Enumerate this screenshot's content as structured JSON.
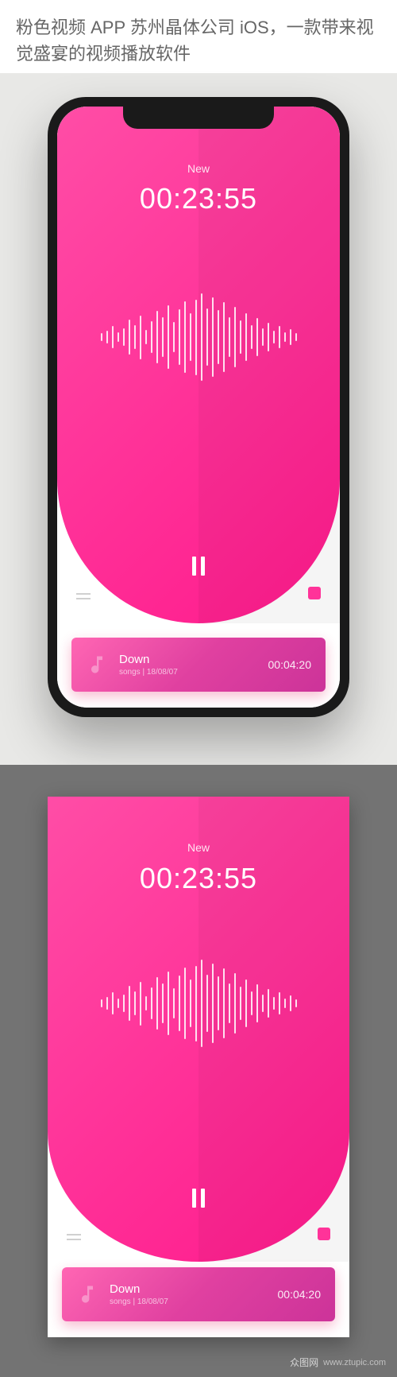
{
  "header": {
    "title": "粉色视频 APP 苏州晶体公司 iOS，一款带来视觉盛宴的视频播放软件"
  },
  "player": {
    "status_label": "New",
    "elapsed_time": "00:23:55"
  },
  "waveform": {
    "bars": [
      10,
      16,
      28,
      12,
      22,
      44,
      30,
      55,
      18,
      40,
      66,
      50,
      80,
      38,
      70,
      90,
      60,
      95,
      110,
      72,
      100,
      68,
      88,
      50,
      76,
      42,
      60,
      30,
      48,
      22,
      36,
      16,
      28,
      12,
      20,
      10
    ]
  },
  "track": {
    "title": "Down",
    "meta_label": "songs",
    "meta_date": "18/08/07",
    "duration": "00:04:20"
  },
  "watermark": {
    "brand": "众图网",
    "url": "www.ztupic.com"
  }
}
